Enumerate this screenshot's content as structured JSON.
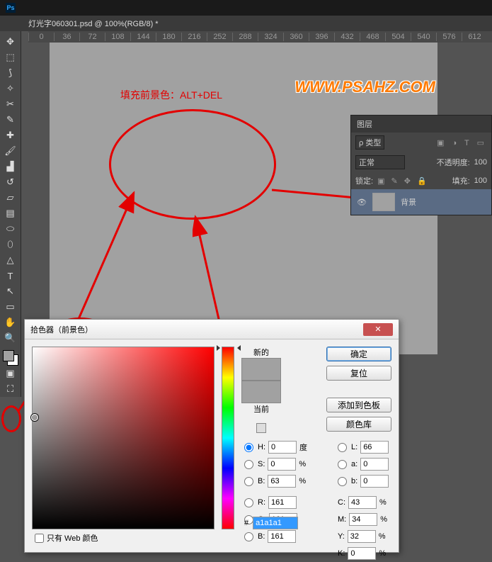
{
  "titlebar": {
    "app": "Ps"
  },
  "docTab": "灯光字060301.psd @ 100%(RGB/8) *",
  "ruler": [
    "0",
    "36",
    "72",
    "108",
    "144",
    "180",
    "216",
    "252",
    "288",
    "324",
    "360",
    "396",
    "432",
    "468",
    "504",
    "540",
    "576",
    "612"
  ],
  "annotation": "填充前景色：ALT+DEL",
  "watermark": "WWW.PSAHZ.COM",
  "layers": {
    "title": "图层",
    "kind": "ρ 类型",
    "blend": "正常",
    "opacityLabel": "不透明度:",
    "opacity": "100",
    "lockLabel": "锁定:",
    "fillLabel": "填充:",
    "fill": "100",
    "layerName": "背景"
  },
  "picker": {
    "title": "拾色器（前景色）",
    "newLabel": "新的",
    "curLabel": "当前",
    "ok": "确定",
    "reset": "复位",
    "add": "添加到色板",
    "lib": "颜色库",
    "H": {
      "l": "H:",
      "v": "0",
      "u": "度"
    },
    "S": {
      "l": "S:",
      "v": "0",
      "u": "%"
    },
    "Bv": {
      "l": "B:",
      "v": "63",
      "u": "%"
    },
    "R": {
      "l": "R:",
      "v": "161"
    },
    "G": {
      "l": "G:",
      "v": "161"
    },
    "B": {
      "l": "B:",
      "v": "161"
    },
    "L": {
      "l": "L:",
      "v": "66"
    },
    "a": {
      "l": "a:",
      "v": "0"
    },
    "b": {
      "l": "b:",
      "v": "0"
    },
    "C": {
      "l": "C:",
      "v": "43",
      "u": "%"
    },
    "M": {
      "l": "M:",
      "v": "34",
      "u": "%"
    },
    "Y": {
      "l": "Y:",
      "v": "32",
      "u": "%"
    },
    "K": {
      "l": "K:",
      "v": "0",
      "u": "%"
    },
    "hex": "a1a1a1",
    "web": "只有 Web 颜色"
  }
}
